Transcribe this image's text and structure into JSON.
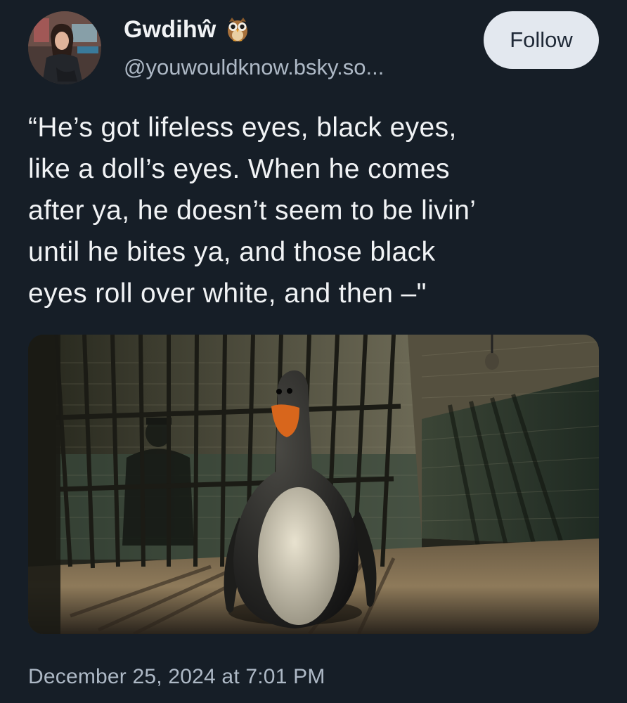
{
  "post": {
    "author": {
      "display_name": "Gwdihŵ",
      "badge_icon": "owl-emoji-icon",
      "handle": "@youwouldknow.bsky.so..."
    },
    "follow_label": "Follow",
    "text": "“He’s got lifeless eyes, black eyes,\nlike a doll’s eyes. When he comes\nafter ya, he doesn’t seem to be livin’\nuntil he bites ya, and those black\neyes roll over white, and then –\"",
    "image": {
      "subject": "penguin figure in a dim prison cell"
    },
    "timestamp": "December 25, 2024 at 7:01 PM"
  },
  "colors": {
    "background": "#161e27",
    "text_primary": "#f1f3f5",
    "text_secondary": "#aeb9c6",
    "follow_button_bg": "#e3e8ef",
    "follow_button_text": "#1f2937"
  }
}
